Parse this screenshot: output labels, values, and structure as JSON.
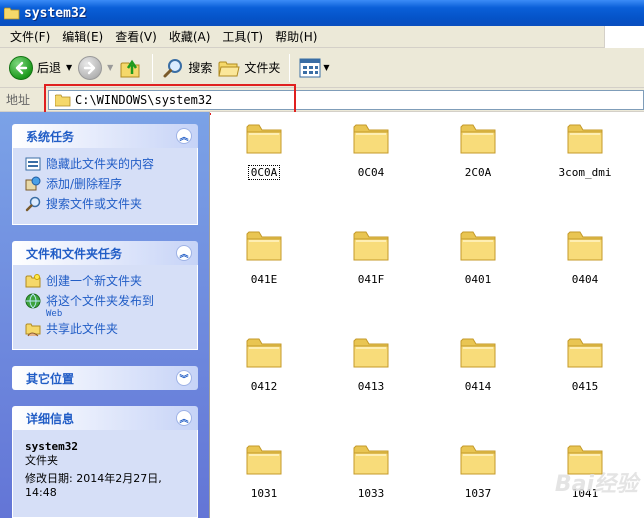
{
  "window": {
    "title": "system32"
  },
  "menu": [
    "文件(F)",
    "编辑(E)",
    "查看(V)",
    "收藏(A)",
    "工具(T)",
    "帮助(H)"
  ],
  "toolbar": {
    "back_label": "后退",
    "search_label": "搜索",
    "folders_label": "文件夹"
  },
  "address": {
    "label": "地址",
    "path": "C:\\WINDOWS\\system32"
  },
  "panels": {
    "system_tasks": {
      "title": "系统任务",
      "items": [
        "隐藏此文件夹的内容",
        "添加/删除程序",
        "搜索文件或文件夹"
      ]
    },
    "file_tasks": {
      "title": "文件和文件夹任务",
      "items": [
        "创建一个新文件夹",
        "将这个文件夹发布到",
        "共享此文件夹"
      ],
      "publish_sub": "Web"
    },
    "other_places": {
      "title": "其它位置"
    },
    "details": {
      "title": "详细信息",
      "name": "system32",
      "type": "文件夹",
      "modified_line1": "修改日期: 2014年2月27日,",
      "modified_line2": "14:48"
    }
  },
  "folders": [
    "0C0A",
    "0C04",
    "2C0A",
    "3com_dmi",
    "041E",
    "041F",
    "0401",
    "0404",
    "0412",
    "0413",
    "0414",
    "0415",
    "1031",
    "1033",
    "1037",
    "1041"
  ],
  "watermark": "Bai经验",
  "colors": {
    "title_blue": "#0553c8",
    "panel_text": "#215dc6",
    "folder_yellow": "#f5d86a",
    "highlight_red": "#e02020"
  }
}
